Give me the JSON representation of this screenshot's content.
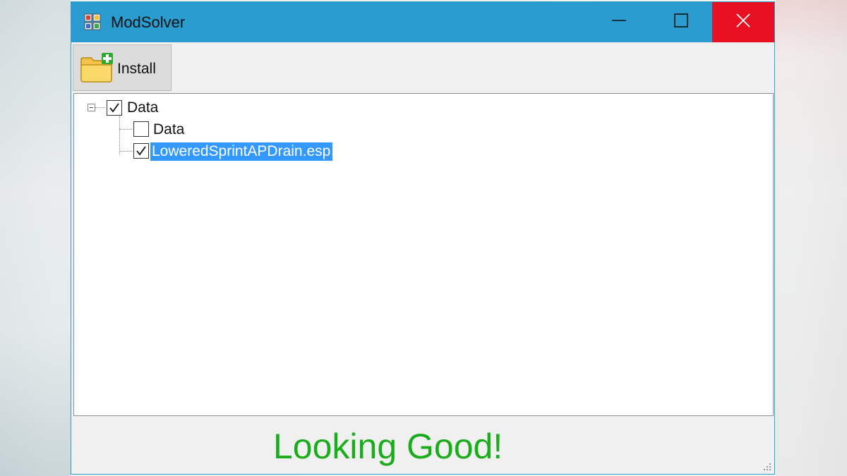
{
  "window": {
    "title": "ModSolver"
  },
  "toolbar": {
    "install_label": "Install"
  },
  "tree": {
    "root": {
      "label": "Data",
      "checked": true,
      "expanded": true,
      "children": [
        {
          "label": "Data",
          "checked": false,
          "selected": false
        },
        {
          "label": "LoweredSprintAPDrain.esp",
          "checked": true,
          "selected": true
        }
      ]
    }
  },
  "status": {
    "text": "Looking Good!"
  },
  "colors": {
    "titlebar": "#2b9ccf",
    "close_button": "#e81123",
    "selection": "#3399ff",
    "status_text": "#1aac1a"
  },
  "icons": {
    "app": "app-icon",
    "install": "folder-add-icon",
    "minimize": "minimize-icon",
    "maximize": "maximize-icon",
    "close": "close-icon",
    "resize_grip": "resize-grip-icon"
  }
}
